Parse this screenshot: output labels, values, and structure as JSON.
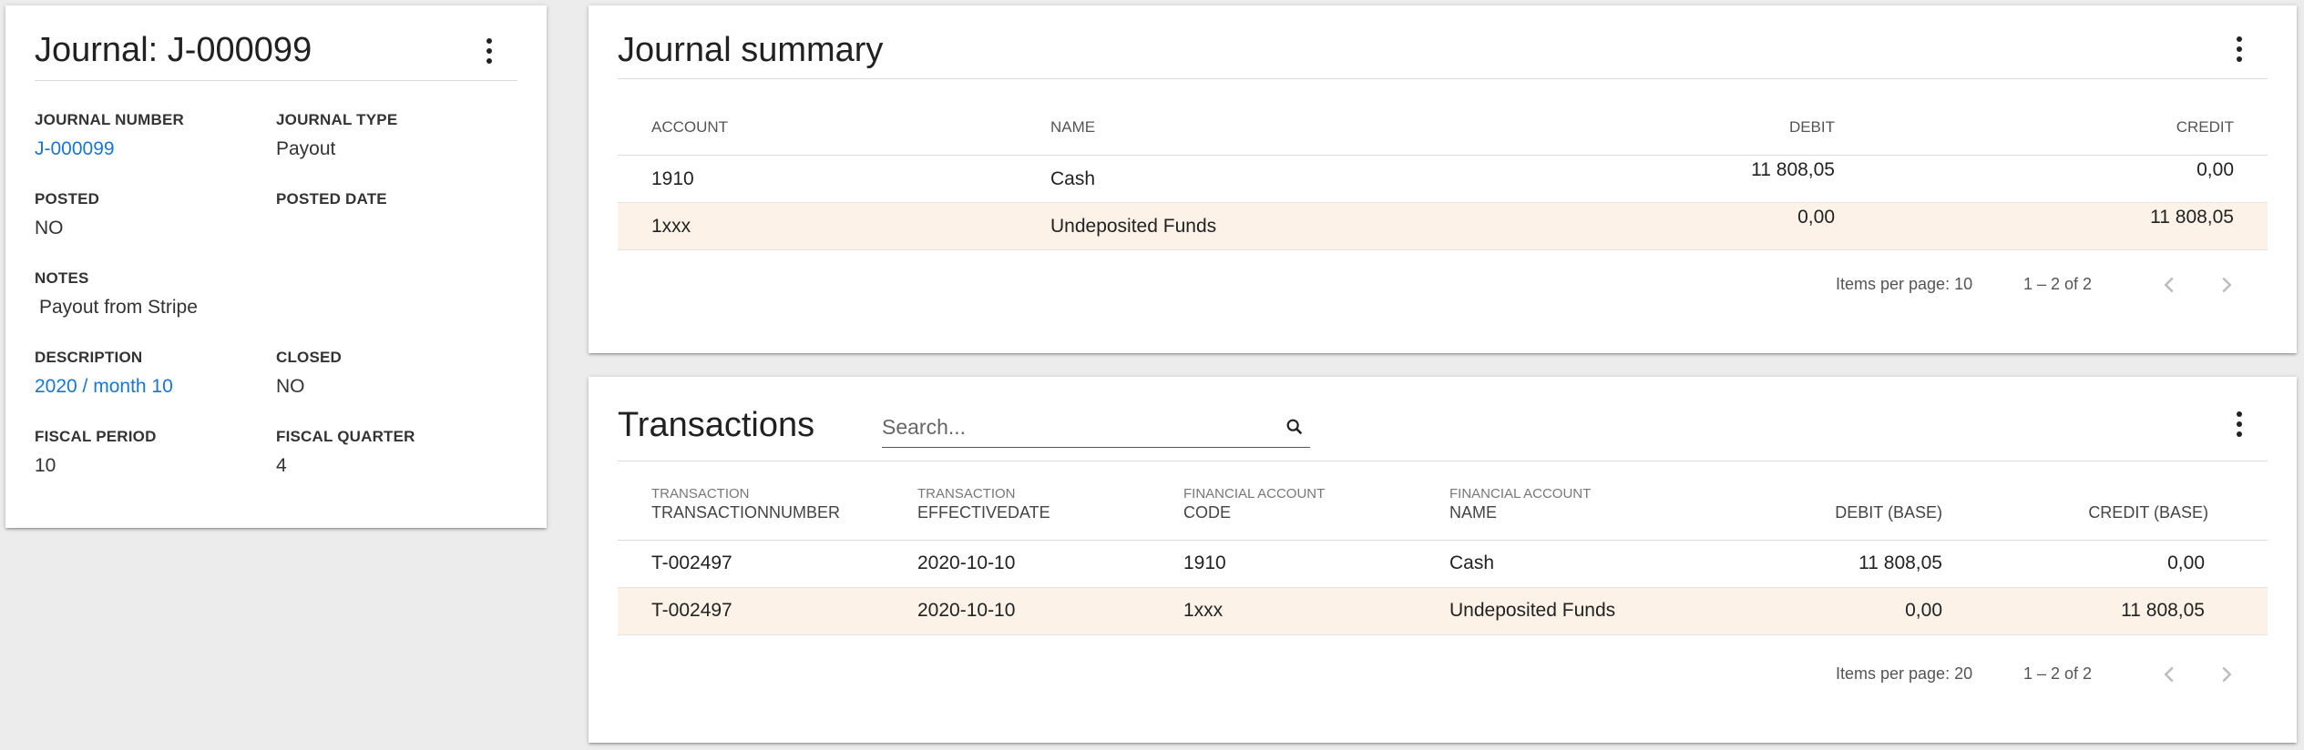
{
  "journal": {
    "title": "Journal: J-000099",
    "fields": {
      "journal_number": {
        "label": "JOURNAL NUMBER",
        "value": "J-000099"
      },
      "journal_type": {
        "label": "JOURNAL TYPE",
        "value": "Payout"
      },
      "posted": {
        "label": "POSTED",
        "value": "NO"
      },
      "posted_date": {
        "label": "POSTED DATE",
        "value": ""
      },
      "notes": {
        "label": "NOTES",
        "value": "Payout from Stripe"
      },
      "description": {
        "label": "DESCRIPTION",
        "value": "2020 / month 10"
      },
      "closed": {
        "label": "CLOSED",
        "value": "NO"
      },
      "fiscal_period": {
        "label": "FISCAL PERIOD",
        "value": "10"
      },
      "fiscal_quarter": {
        "label": "FISCAL QUARTER",
        "value": "4"
      }
    },
    "menu_icon": "more-vert-icon"
  },
  "summary": {
    "title": "Journal summary",
    "columns": {
      "account": "ACCOUNT",
      "name": "NAME",
      "debit": "DEBIT",
      "credit": "CREDIT"
    },
    "rows": [
      {
        "account": "1910",
        "name": "Cash",
        "debit": "11 808,05",
        "credit": "0,00"
      },
      {
        "account": "1xxx",
        "name": "Undeposited Funds",
        "debit": "0,00",
        "credit": "11 808,05"
      }
    ],
    "paginator": {
      "items_per_page": "Items per page: 10",
      "range": "1 – 2 of 2"
    },
    "menu_icon": "more-vert-icon"
  },
  "transactions": {
    "title": "Transactions",
    "search": {
      "placeholder": "Search...",
      "value": ""
    },
    "columns": {
      "tx_number": {
        "sub": "TRANSACTION",
        "main": "TRANSACTIONNUMBER"
      },
      "effective_date": {
        "sub": "TRANSACTION",
        "main": "EFFECTIVEDATE"
      },
      "fa_code": {
        "sub": "FINANCIAL ACCOUNT",
        "main": "CODE"
      },
      "fa_name": {
        "sub": "FINANCIAL ACCOUNT",
        "main": "NAME"
      },
      "debit_base": "DEBIT (BASE)",
      "credit_base": "CREDIT (BASE)"
    },
    "rows": [
      {
        "tx_number": "T-002497",
        "effective_date": "2020-10-10",
        "fa_code": "1910",
        "fa_name": "Cash",
        "debit": "11 808,05",
        "credit": "0,00"
      },
      {
        "tx_number": "T-002497",
        "effective_date": "2020-10-10",
        "fa_code": "1xxx",
        "fa_name": "Undeposited Funds",
        "debit": "0,00",
        "credit": "11 808,05"
      }
    ],
    "paginator": {
      "items_per_page": "Items per page: 20",
      "range": "1 – 2 of 2"
    },
    "menu_icon": "more-vert-icon"
  },
  "colors": {
    "link": "#1976d2",
    "row_highlight": "#fdf2e7",
    "background": "#ececec"
  }
}
